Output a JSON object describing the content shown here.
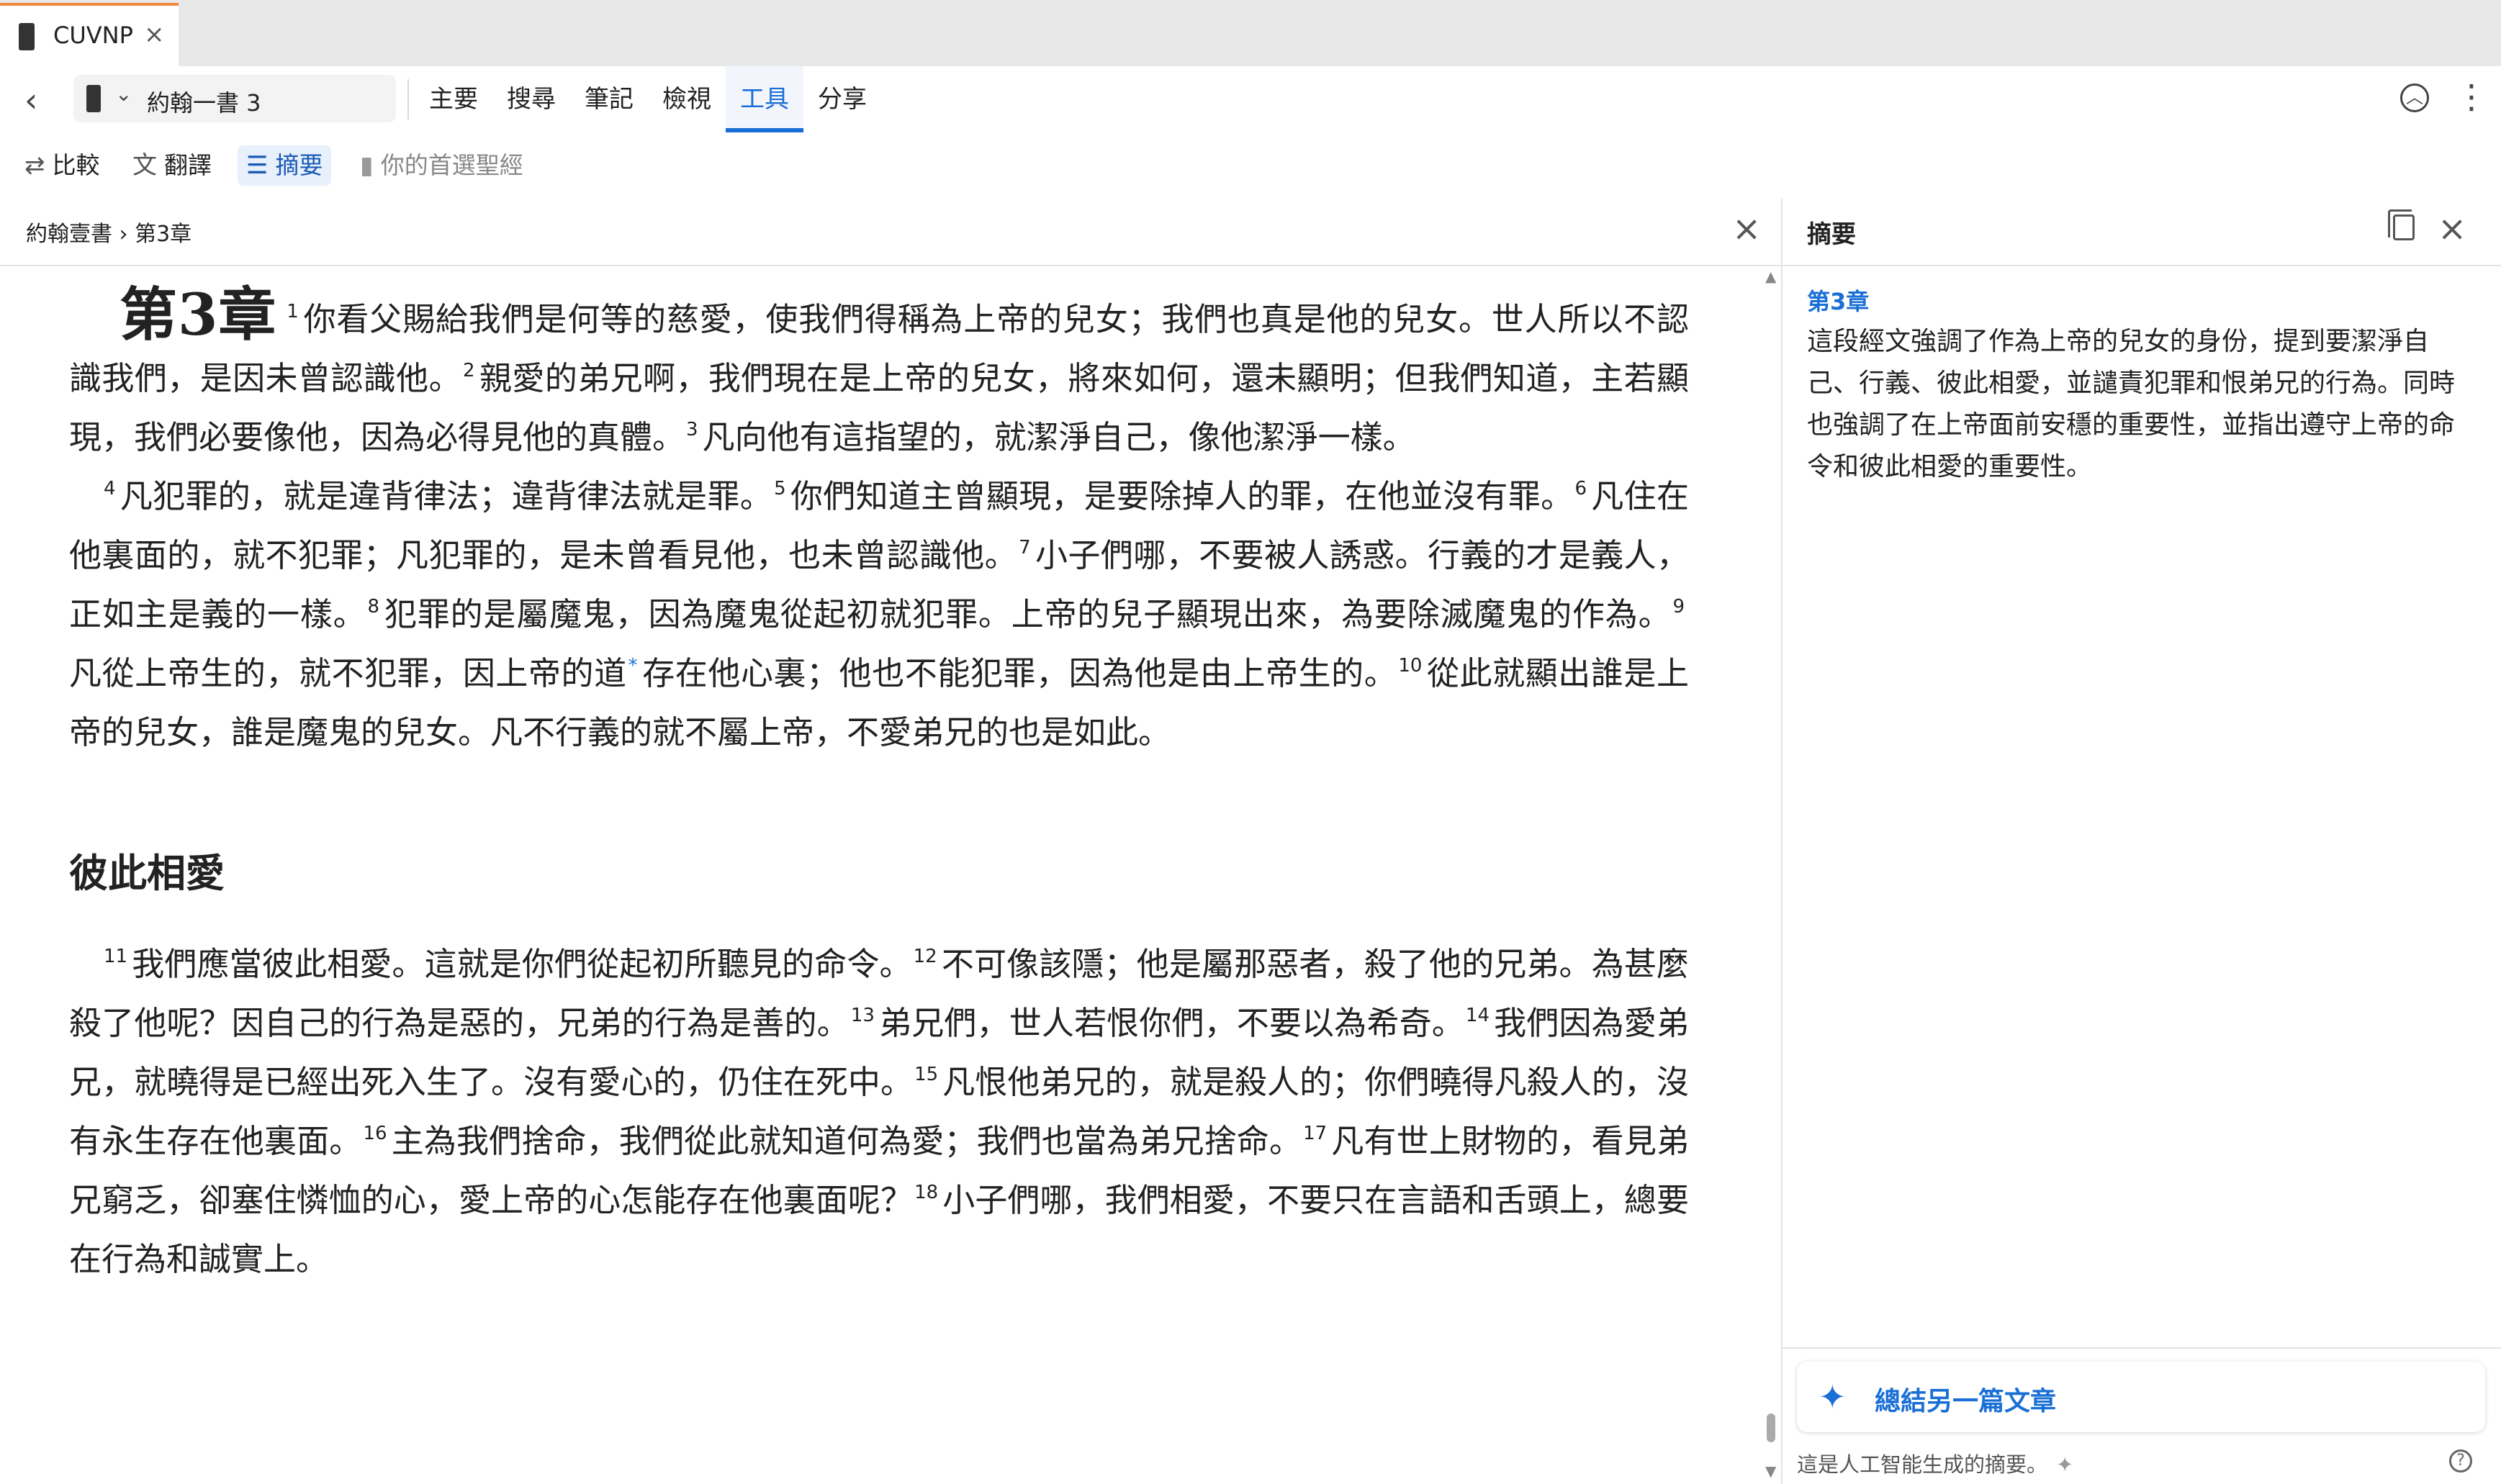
{
  "tab": {
    "title": "CUVNP",
    "close": "×"
  },
  "nav": {
    "back": "‹",
    "book": "約翰一書 3",
    "menu": [
      "主要",
      "搜尋",
      "筆記",
      "檢視",
      "工具",
      "分享"
    ],
    "active_menu": "工具",
    "more": "⋮"
  },
  "tools": {
    "compare": "比較",
    "translate": "翻譯",
    "summary": "摘要",
    "preferred": "你的首選聖經"
  },
  "reader": {
    "breadcrumb": "約翰壹書 › 第3章",
    "chapter_label": "第3章",
    "section_heading": "彼此相愛",
    "v1": "你看父賜給我們是何等的慈愛，使我們得稱為上帝的兒女；我們也真是他的兒女。世人所以不認識我們，是因未曾認識他。",
    "v2": "親愛的弟兄啊，我們現在是上帝的兒女，將來如何，還未顯明；但我們知道，主若顯現，我們必要像他，因為必得見他的真體。",
    "v3": "凡向他有這指望的，就潔淨自己，像他潔淨一樣。",
    "v4": "凡犯罪的，就是違背律法；違背律法就是罪。",
    "v5": "你們知道主曾顯現，是要除掉人的罪，在他並沒有罪。",
    "v6": "凡住在他裏面的，就不犯罪；凡犯罪的，是未曾看見他，也未曾認識他。",
    "v7": "小子們哪，不要被人誘惑。行義的才是義人，正如主是義的一樣。",
    "v8": "犯罪的是屬魔鬼，因為魔鬼從起初就犯罪。上帝的兒子顯現出來，為要除滅魔鬼的作為。",
    "v9a": "凡從上帝生的，就不犯罪，因上帝的道",
    "v9_mark": "*",
    "v9b": "存在他心裏；他也不能犯罪，因為他是由上帝生的。",
    "v10": "從此就顯出誰是上帝的兒女，誰是魔鬼的兒女。凡不行義的就不屬上帝，不愛弟兄的也是如此。",
    "v11": "我們應當彼此相愛。這就是你們從起初所聽見的命令。",
    "v12": "不可像該隱；他是屬那惡者，殺了他的兄弟。為甚麼殺了他呢？因自己的行為是惡的，兄弟的行為是善的。",
    "v13": "弟兄們，世人若恨你們，不要以為希奇。",
    "v14": "我們因為愛弟兄，就曉得是已經出死入生了。沒有愛心的，仍住在死中。",
    "v15": "凡恨他弟兄的，就是殺人的；你們曉得凡殺人的，沒有永生存在他裏面。",
    "v16": "主為我們捨命，我們從此就知道何為愛；我們也當為弟兄捨命。",
    "v17": "凡有世上財物的，看見弟兄窮乏，卻塞住憐恤的心，愛上帝的心怎能存在他裏面呢？",
    "v18": "小子們哪，我們相愛，不要只在言語和舌頭上，總要在行為和誠實上。"
  },
  "summary_panel": {
    "title": "摘要",
    "heading": "第3章",
    "text": "這段經文強調了作為上帝的兒女的身份，提到要潔淨自己、行義、彼此相愛，並譴責犯罪和恨弟兄的行為。同時也強調了在上帝面前安穩的重要性，並指出遵守上帝的命令和彼此相愛的重要性。",
    "generate_button": "總結另一篇文章",
    "disclaimer": "這是人工智能生成的摘要。"
  },
  "icons": {
    "tab_book": "book-icon",
    "compare": "arrows-swap-icon",
    "translate": "translate-icon",
    "summary": "list-summary-icon",
    "preferred": "bookmark-icon",
    "copy": "copy-icon",
    "sparkle": "sparkle-icon",
    "help": "help-icon"
  },
  "colors": {
    "accent": "#1a6fd6",
    "tab_accent": "#f08a3c"
  }
}
